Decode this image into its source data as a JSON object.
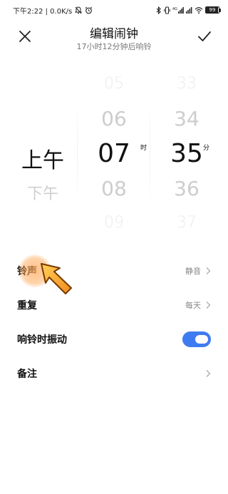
{
  "status_bar": {
    "time_speed": "下午2:22 | 0.0K/s",
    "battery": "99",
    "network": "4G"
  },
  "header": {
    "title": "编辑闹钟",
    "subtitle": "17小时12分钟后响铃",
    "close_icon": "close-icon",
    "confirm_icon": "checkmark-icon"
  },
  "picker": {
    "ampm": {
      "selected": "上午",
      "below": "下午"
    },
    "hour": {
      "above2": "05",
      "above1": "06",
      "selected": "07",
      "below1": "08",
      "below2": "09",
      "unit": "时"
    },
    "minute": {
      "above2": "33",
      "above1": "34",
      "selected": "35",
      "below1": "36",
      "below2": "37",
      "unit": "分"
    }
  },
  "settings": {
    "ringtone": {
      "label": "铃声",
      "value": "静音"
    },
    "repeat": {
      "label": "重复",
      "value": "每天"
    },
    "vibrate": {
      "label": "响铃时振动",
      "enabled": true
    },
    "note": {
      "label": "备注"
    }
  },
  "colors": {
    "accent": "#3e7bf0",
    "tutorial_arrow": "#f08a1c"
  }
}
